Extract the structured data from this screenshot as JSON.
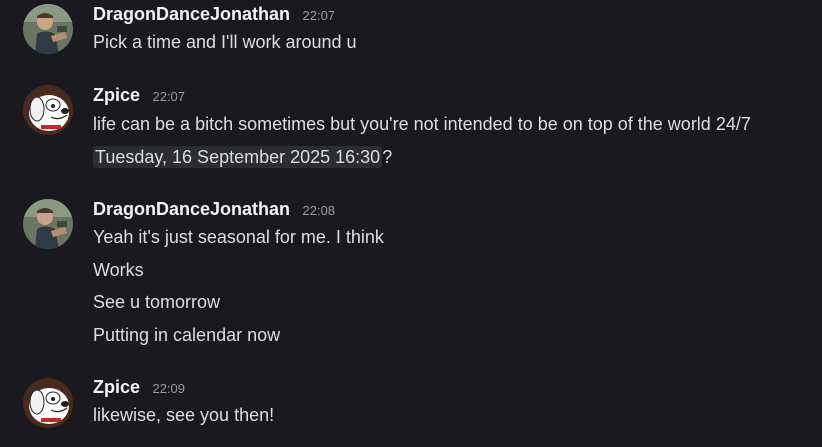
{
  "messages": [
    {
      "author": "DragonDanceJonathan",
      "time": "22:07",
      "avatar_icon": "jonathan-avatar-photo",
      "lines": [
        "Pick a time and I'll work around u"
      ]
    },
    {
      "author": "Zpice",
      "time": "22:07",
      "avatar_icon": "dog-avatar",
      "lines": [
        "life can be a bitch sometimes but you're not intended to be on top of the world 24/7"
      ],
      "date_chip": "Tuesday, 16 September 2025 16:30",
      "date_suffix": "?"
    },
    {
      "author": "DragonDanceJonathan",
      "time": "22:08",
      "avatar_icon": "jonathan-avatar-photo",
      "lines": [
        "Yeah it's just seasonal for me. I think",
        "Works",
        "See u tomorrow",
        "Putting in calendar now"
      ]
    },
    {
      "author": "Zpice",
      "time": "22:09",
      "avatar_icon": "dog-avatar",
      "lines": [
        "likewise, see you then!"
      ]
    }
  ]
}
